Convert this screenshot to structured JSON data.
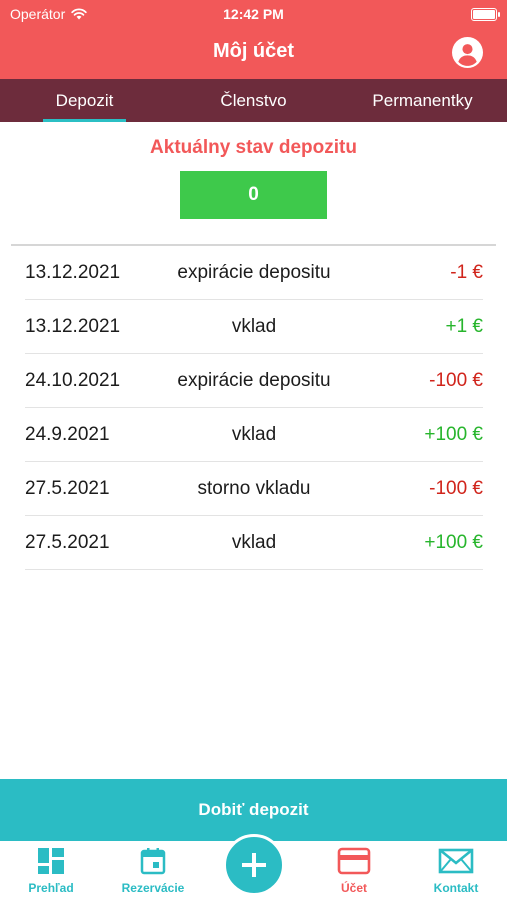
{
  "status_bar": {
    "carrier": "Operátor",
    "time": "12:42 PM"
  },
  "header": {
    "title": "Môj účet"
  },
  "tabs": [
    {
      "label": "Depozit",
      "active": true
    },
    {
      "label": "Členstvo",
      "active": false
    },
    {
      "label": "Permanentky",
      "active": false
    }
  ],
  "deposit": {
    "title": "Aktuálny stav depozitu",
    "balance": "0"
  },
  "transactions": [
    {
      "date": "13.12.2021",
      "description": "expirácie depositu",
      "amount": "-1 €",
      "type": "negative"
    },
    {
      "date": "13.12.2021",
      "description": "vklad",
      "amount": "+1 €",
      "type": "positive"
    },
    {
      "date": "24.10.2021",
      "description": "expirácie depositu",
      "amount": "-100 €",
      "type": "negative"
    },
    {
      "date": "24.9.2021",
      "description": "vklad",
      "amount": "+100 €",
      "type": "positive"
    },
    {
      "date": "27.5.2021",
      "description": "storno vkladu",
      "amount": "-100 €",
      "type": "negative"
    },
    {
      "date": "27.5.2021",
      "description": "vklad",
      "amount": "+100 €",
      "type": "positive"
    }
  ],
  "topup_button": {
    "label": "Dobiť depozit"
  },
  "tabbar": {
    "overview": "Prehľad",
    "reservations": "Rezervácie",
    "account": "Účet",
    "contact": "Kontakt"
  },
  "colors": {
    "header": "#f25859",
    "tabs_bg": "#6d2c3c",
    "accent": "#2bbcc4",
    "balance_bg": "#3ec94b",
    "negative": "#d0241b",
    "positive": "#27b52c"
  }
}
